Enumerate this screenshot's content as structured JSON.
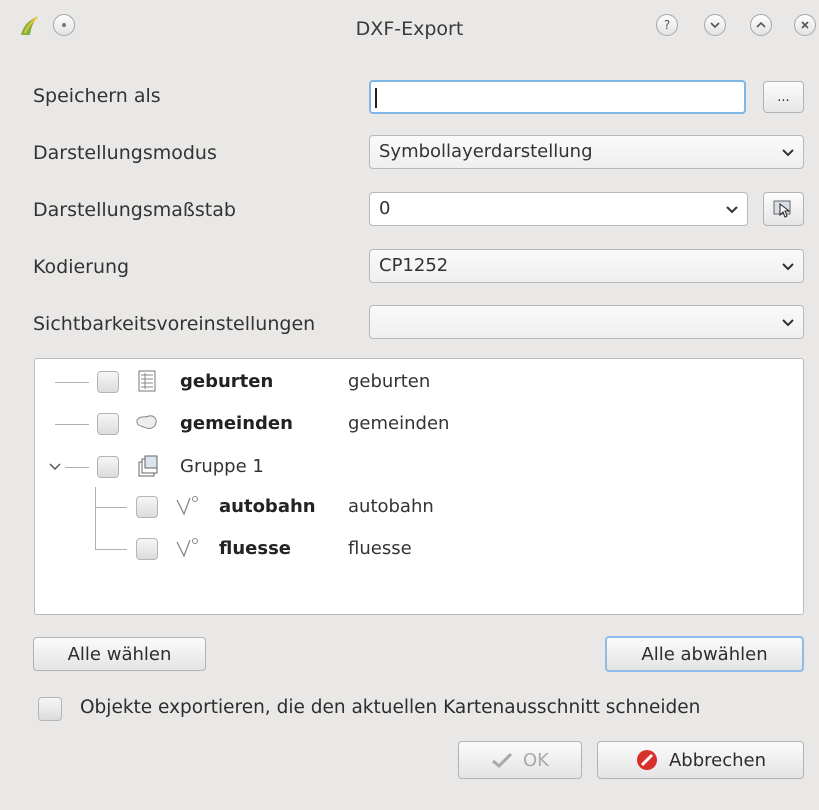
{
  "window": {
    "title": "DXF-Export"
  },
  "form": {
    "save_as_label": "Speichern als",
    "save_as_value": "",
    "browse_label": "...",
    "mode_label": "Darstellungsmodus",
    "mode_value": "Symbollayerdarstellung",
    "scale_label": "Darstellungsmaßstab",
    "scale_value": "0",
    "encoding_label": "Kodierung",
    "encoding_value": "CP1252",
    "visibility_label": "Sichtbarkeitsvoreinstellungen",
    "visibility_value": ""
  },
  "tree": {
    "items": [
      {
        "name": "geburten",
        "layer": "geburten",
        "icon": "table-icon"
      },
      {
        "name": "gemeinden",
        "layer": "gemeinden",
        "icon": "polygon-icon"
      },
      {
        "name": "Gruppe 1",
        "layer": "",
        "icon": "group-icon"
      },
      {
        "name": "autobahn",
        "layer": "autobahn",
        "icon": "line-icon"
      },
      {
        "name": "fluesse",
        "layer": "fluesse",
        "icon": "line-icon"
      }
    ]
  },
  "buttons": {
    "select_all": "Alle wählen",
    "deselect_all": "Alle abwählen",
    "ok": "OK",
    "cancel": "Abbrechen"
  },
  "options": {
    "intersect_label": "Objekte exportieren, die den aktuellen Kartenausschnitt schneiden"
  },
  "colors": {
    "focus": "#7fb6e6",
    "cancel_icon": "#d9302c",
    "window_bg": "#e9e8e6"
  }
}
